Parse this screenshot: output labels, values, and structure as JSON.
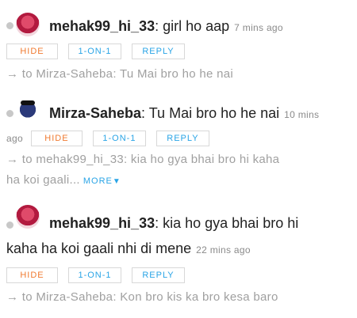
{
  "buttons": {
    "hide": "HIDE",
    "one_on_one": "1-ON-1",
    "reply": "REPLY"
  },
  "more_label": "MORE",
  "messages": [
    {
      "user": "mehak99_hi_33",
      "text": "girl ho aap",
      "time": "7 mins ago",
      "reply_to": "→ to Mirza-Saheba: Tu Mai bro ho he nai"
    },
    {
      "user": "Mirza-Saheba",
      "text": "Tu Mai bro ho he nai",
      "time_part1": "10 mins",
      "time_part2": "ago",
      "reply_to_line1": "→ to mehak99_hi_33: kia ho gya bhai bro hi kaha",
      "reply_to_line2": "ha koi gaali..."
    },
    {
      "user": "mehak99_hi_33",
      "text_line1": "kia ho gya bhai bro hi",
      "text_line2": "kaha ha koi gaali nhi di mene",
      "time": "22 mins ago",
      "reply_to": "→ to Mirza-Saheba: Kon bro kis ka bro kesa baro"
    }
  ]
}
